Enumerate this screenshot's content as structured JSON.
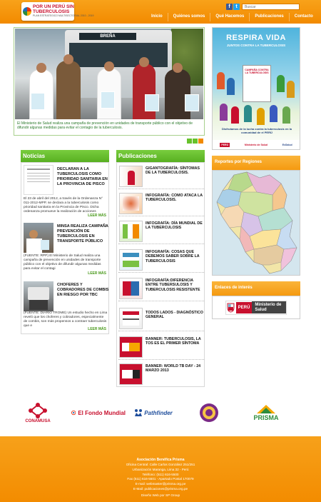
{
  "header": {
    "logo": {
      "line1": "POR UN PERÚ SIN",
      "line2": "TUBERCULOSIS",
      "line3": "PLAN ESTRATEGICO MULTISECTORIAL 2010 - 2019"
    },
    "search_placeholder": "Buscar",
    "social": {
      "facebook": "f",
      "twitter": "t"
    },
    "nav": [
      "Inicio",
      "Quiénes somos",
      "Qué Hacemos",
      "Publicaciones",
      "Contacto"
    ]
  },
  "hero": {
    "bus_sign": "BREÑA",
    "caption": "El Ministerio de Salud realiza una campaña de prevención en unidades de transporte público con el objetivo de difundir algunas medidas para evitar el contagio de la tuberculosis.",
    "slides": 3,
    "active_slide": 3
  },
  "poster": {
    "title": "RESPIRA VIDA",
    "subtitle": "JUNTOS CONTRA LA TUBERCULOSIS",
    "board_text": "CAMPAÑA CONTRA LA TUBERCULOSIS",
    "slogan": "Disfrutamos de la lucha contra la tuberculosis en la comunidad de el PERÚ",
    "footer": [
      "PERÚ",
      "Ministerio de Salud",
      "EsSalud"
    ]
  },
  "noticias": {
    "heading": "Noticias",
    "more_label": "LEER MÁS",
    "items": [
      {
        "title": "DECLARAN A LA TUBERCULOSIS COMO PRIORIDAD SANITARIA EN LA PROVINCIA DE PISCO",
        "text": "El 23 de abril del 2012, a través de la Ordenanza N° 011-2012-MPP, se declara a la tuberculosis como prioridad sanitaria en la Provincia de Pisco. Dicha ordenanza promueve la realización de acciones"
      },
      {
        "title": "MINSA REALIZA CAMPAÑA PREVENCIÓN DE TUBERCULOSIS EN TRANSPORTE PÚBLICO",
        "text": "(FUENTE: RPP) El Ministerio de Salud realiza una campaña de prevención en unidades de transporte público con el objetivo de difundir algunas medidas para evitar el contagi"
      },
      {
        "title": "CHOFERES Y COBRADORES DE COMBIS EN RIESGO POR TBC",
        "text": "(FUENTE: DIARIO TROME) Un estudio hecho en Lima reveló que los choferes y cobradores, especialmente de combis, son más propensos a contraer tuberculosis que e"
      }
    ]
  },
  "publicaciones": {
    "heading": "Publicaciones",
    "items": [
      "GIGANTOGRAFÍA: SÍNTOMAS DE LA TUBERCULOSIS.",
      "INFOGRAFÍA: COMO ATACA LA TUBERCULOSIS.",
      "INFOGRAFÍA: DÍA MUNDIAL DE LA TUBERCULOSIS",
      "INFOGRAFÍA: COSAS QUE DEBEMOS SABER SOBRE LA TUBERCULOSIS",
      "INFOGRAFÍA:DIFERENCIA ENTRE TUBERSULOSIS Y TUBERCULOSIS RESISTENTE",
      "TODOS LADOS - DIAGNÓSTICO GENERAL",
      "BANNER: TUBERCULOSIS, LA TOS ES EL PRIMER SÍNTOMA",
      "BANNER: WORLD TB DAY - 24 MARZO 2013"
    ]
  },
  "reportes": {
    "heading": "Reportes por Regiones"
  },
  "enlaces": {
    "heading": "Enlaces de interés",
    "minsa": {
      "country": "PERÚ",
      "name": "Ministerio de Salud"
    }
  },
  "partners": [
    {
      "name": "CONAMUSA",
      "color": "#c8102e"
    },
    {
      "name": "El Fondo Mundial",
      "color": "#c8102e"
    },
    {
      "name": "Pathfinder",
      "color": "#1f4e9c"
    },
    {
      "name": "",
      "color": "#7a2a86"
    },
    {
      "name": "PRISMA",
      "color": "#2c8c3c"
    }
  ],
  "footer": {
    "org": "Asociación Benéfica Prisma",
    "address": "Oficina Central: Calle Carlos González 251/251",
    "district": "Urbanización Maranga, Lima 32 - Perú",
    "phone": "Teléfono: (511) 616-5500",
    "fax": "Fax (511) 616-5501 - Apartado Postal 170079",
    "email": "E-mail: webmaster@prisma.org.pe",
    "email2": "E-Mail: publicaciones@prisma.org.pe",
    "credit": "Diseño Web por SP Group"
  },
  "colors": {
    "orange": "#f28a00",
    "green": "#58b021",
    "green_text": "#4a9a1c"
  }
}
